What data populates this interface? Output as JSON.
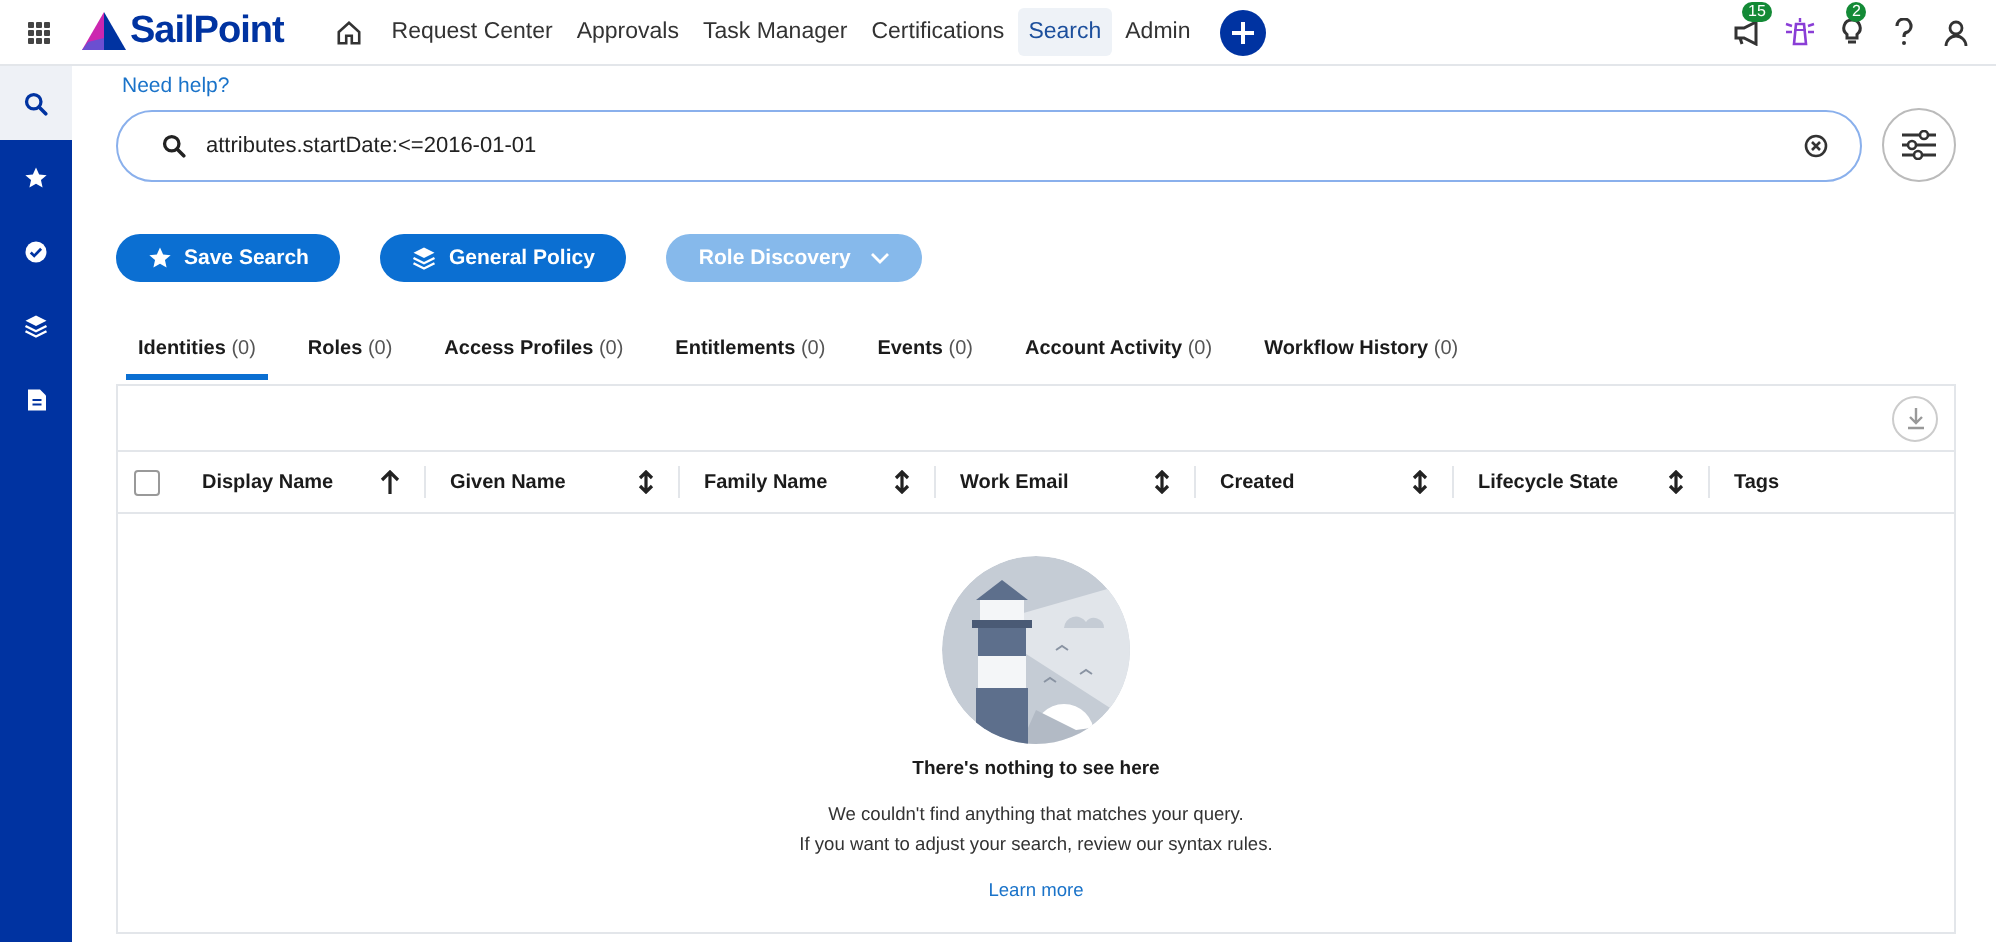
{
  "header": {
    "logo": "SailPoint",
    "nav": [
      {
        "label": "Request Center",
        "selected": false
      },
      {
        "label": "Approvals",
        "selected": false
      },
      {
        "label": "Task Manager",
        "selected": false
      },
      {
        "label": "Certifications",
        "selected": false
      },
      {
        "label": "Search",
        "selected": true
      },
      {
        "label": "Admin",
        "selected": false
      }
    ],
    "tools": [
      {
        "kind": "megaphone",
        "badge": "15"
      },
      {
        "kind": "lighthouse"
      },
      {
        "kind": "bulb",
        "badge": "2"
      },
      {
        "kind": "help"
      },
      {
        "kind": "user"
      }
    ]
  },
  "sidebar": {
    "items": [
      {
        "kind": "search",
        "selected": true
      },
      {
        "kind": "star",
        "selected": false
      },
      {
        "kind": "check",
        "selected": false
      },
      {
        "kind": "layers",
        "selected": false
      },
      {
        "kind": "document",
        "selected": false
      }
    ]
  },
  "search": {
    "help_link": "Need help?",
    "value": "attributes.startDate:<=2016-01-01"
  },
  "actions": [
    {
      "label": "Save Search",
      "kind": "star",
      "disabled": false
    },
    {
      "label": "General Policy",
      "kind": "layers",
      "disabled": false
    },
    {
      "label": "Role Discovery",
      "kind": "dropdown",
      "disabled": true
    }
  ],
  "tabs": [
    {
      "label": "Identities",
      "count": "(0)",
      "selected": true
    },
    {
      "label": "Roles",
      "count": "(0)",
      "selected": false
    },
    {
      "label": "Access Profiles",
      "count": "(0)",
      "selected": false
    },
    {
      "label": "Entitlements",
      "count": "(0)",
      "selected": false
    },
    {
      "label": "Events",
      "count": "(0)",
      "selected": false
    },
    {
      "label": "Account Activity",
      "count": "(0)",
      "selected": false
    },
    {
      "label": "Workflow History",
      "count": "(0)",
      "selected": false
    }
  ],
  "table": {
    "select_all_checked": false,
    "columns": [
      {
        "label": "Display Name",
        "kind": "ascending"
      },
      {
        "label": "Given Name",
        "kind": "sortable"
      },
      {
        "label": "Family Name",
        "kind": "sortable"
      },
      {
        "label": "Work Email",
        "kind": "sortable"
      },
      {
        "label": "Created",
        "kind": "sortable"
      },
      {
        "label": "Lifecycle State",
        "kind": "sortable"
      },
      {
        "label": "Tags",
        "kind": "plain"
      }
    ],
    "empty": {
      "title": "There's nothing to see here",
      "message_lines": [
        "We couldn't find anything that matches your query.",
        "If you want to adjust your search, review our syntax rules."
      ],
      "link": "Learn more"
    }
  }
}
